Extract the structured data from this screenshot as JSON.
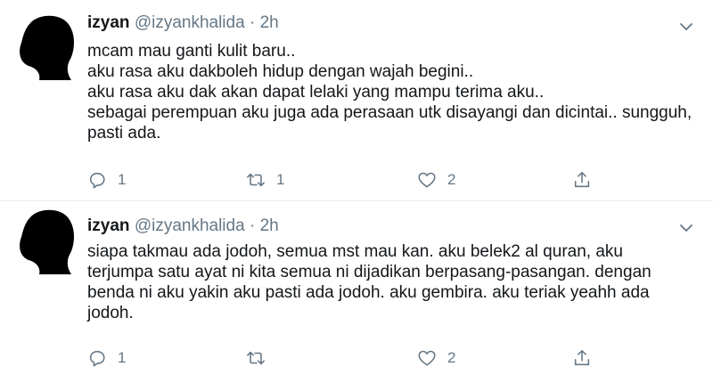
{
  "tweets": [
    {
      "name": "izyan",
      "handle": "@izyankhalida",
      "separator": "·",
      "time": "2h",
      "lines": [
        "mcam mau ganti kulit baru..",
        "aku rasa aku dakboleh hidup dengan wajah begini..",
        "aku rasa aku dak akan dapat lelaki yang mampu terima aku..",
        "sebagai perempuan aku juga ada perasaan utk disayangi dan dicintai..  sungguh,",
        "pasti ada."
      ],
      "replies": "1",
      "retweets": "1",
      "likes": "2"
    },
    {
      "name": "izyan",
      "handle": "@izyankhalida",
      "separator": "·",
      "time": "2h",
      "lines": [
        "siapa takmau ada jodoh,  semua mst mau kan.  aku belek2 al quran,  aku",
        "terjumpa satu ayat ni kita semua ni dijadikan berpasang-pasangan. dengan",
        "benda ni aku yakin aku pasti ada jodoh.  aku gembira. aku teriak yeahh ada",
        "jodoh."
      ],
      "replies": "1",
      "retweets": "",
      "likes": "2"
    }
  ],
  "icons": {
    "avatar": "woman-silhouette-icon",
    "caret": "chevron-down-icon",
    "reply": "reply-icon",
    "retweet": "retweet-icon",
    "like": "heart-icon",
    "share": "share-icon"
  },
  "colors": {
    "text": "#14171a",
    "secondary": "#657786",
    "divider": "#e6ecf0"
  }
}
